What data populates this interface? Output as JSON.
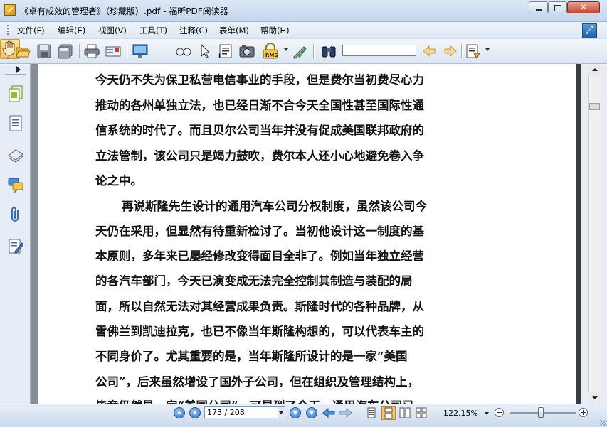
{
  "window": {
    "title": "《卓有成效的管理者》（珍藏版）.pdf - 福昕PDF阅读器"
  },
  "menu": {
    "items": [
      {
        "label": "文件(F)"
      },
      {
        "label": "编辑(E)"
      },
      {
        "label": "视图(V)"
      },
      {
        "label": "工具(T)"
      },
      {
        "label": "注释(C)"
      },
      {
        "label": "表单(M)"
      },
      {
        "label": "帮助(H)"
      }
    ]
  },
  "toolbar": {
    "rms_label": "RMS",
    "find_value": "",
    "icons": [
      "open-icon",
      "save-icon",
      "save-as-icon",
      "print-icon",
      "email-icon",
      "fullscreen-icon",
      "hand-tool-icon",
      "zoom-loupe-icon",
      "select-arrow-icon",
      "text-select-icon",
      "snapshot-icon",
      "rms-lock-icon",
      "sign-icon",
      "find-binoculars-icon",
      "find-prev-icon",
      "find-next-icon",
      "highlight-icon"
    ]
  },
  "side_panel": {
    "icons": [
      "pages-icon",
      "bookmarks-icon",
      "layers-icon",
      "comments-icon",
      "attachments-icon",
      "signatures-icon"
    ]
  },
  "document": {
    "lines": [
      "今天仍不失为保卫私营电信事业的手段，但是费尔当初费尽心力",
      "推动的各州单独立法，也已经日渐不合今天全国性甚至国际性通",
      "信系统的时代了。而且贝尔公司当年并没有促成美国联邦政府的",
      "立法管制，该公司只是竭力鼓吹，费尔本人还小心地避免卷入争",
      "论之中。",
      "再说斯隆先生设计的通用汽车公司分权制度，虽然该公司今",
      "天仍在采用，但显然有待重新检讨了。当初他设计这一制度的基",
      "本原则，多年来已屡经修改变得面目全非了。例如当年独立经营",
      "的各汽车部门，今天已演变成无法完全控制其制造与装配的局",
      "面，所以自然无法对其经营成果负责。斯隆时代的各种品牌，从",
      "雪佛兰到凯迪拉克，也已不像当年斯隆构想的，可以代表车主的",
      "不同身价了。尤其重要的是，当年斯隆所设计的是一家“美国",
      "公司”，后来虽然增设了国外子公司，但在组织及管理结构上，",
      "毕竟仍然是一家“美国公司”，可是到了今天，通用汽车公司已"
    ]
  },
  "statusbar": {
    "page_display": "173 / 208",
    "current_page": 173,
    "total_pages": 208,
    "zoom": "122.15%",
    "zoom_slider_fraction": 0.47
  },
  "colors": {
    "chrome_blue": "#cfdbe9",
    "doc_background": "#8a8f96",
    "page": "#ffffff",
    "accent_blue": "#2e6fc0"
  }
}
